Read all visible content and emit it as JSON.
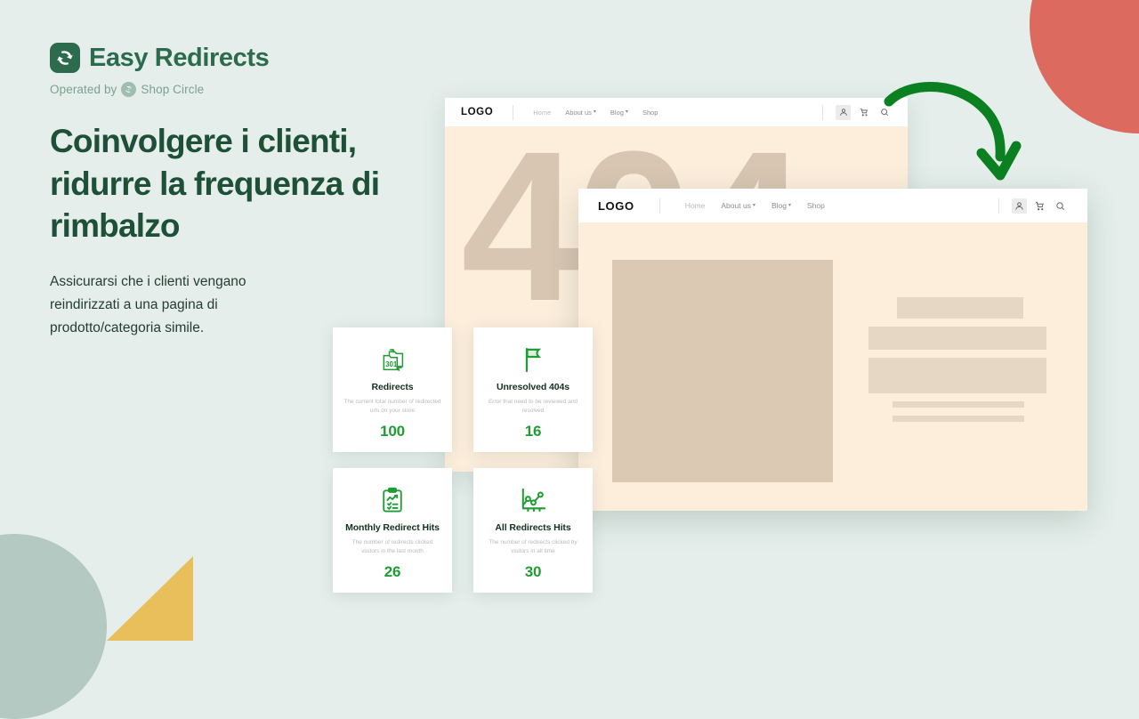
{
  "colors": {
    "background": "#e5eeea",
    "brand_green": "#2d6b4f",
    "headline_green": "#1d5037",
    "accent_green": "#1f9c34",
    "arrow_green": "#0b8020",
    "coral": "#dd6a5e",
    "sage": "#b3c9c2",
    "yellow": "#e9bf5b",
    "cream": "#fdeedc",
    "tan": "#d8c6b2"
  },
  "brand": {
    "name": "Easy Redirects",
    "logo_icon": "redirect-arrows-icon",
    "operated_by_prefix": "Operated by",
    "operated_by_company": "Shop Circle",
    "operated_by_icon": "shop-circle-icon"
  },
  "hero": {
    "headline": "Coinvolgere i clienti, ridurre la frequenza di rimbalzo",
    "subcopy": "Assicurarsi che i clienti vengano reindirizzati a una pagina di prodotto/categoria simile."
  },
  "arrow": {
    "icon": "curved-down-arrow-icon"
  },
  "browser_back": {
    "nav": {
      "logo": "LOGO",
      "links": [
        {
          "label": "Home",
          "has_caret": false,
          "active": true
        },
        {
          "label": "About us",
          "has_caret": true,
          "active": false
        },
        {
          "label": "Blog",
          "has_caret": true,
          "active": false
        },
        {
          "label": "Shop",
          "has_caret": false,
          "active": false
        }
      ],
      "icons": [
        "user-icon",
        "cart-icon",
        "search-icon"
      ]
    },
    "error_code": "404"
  },
  "browser_front": {
    "nav": {
      "logo": "LOGO",
      "links": [
        {
          "label": "Home",
          "has_caret": false,
          "active": true
        },
        {
          "label": "About us",
          "has_caret": true,
          "active": false
        },
        {
          "label": "Blog",
          "has_caret": true,
          "active": false
        },
        {
          "label": "Shop",
          "has_caret": false,
          "active": false
        }
      ],
      "icons": [
        "user-icon",
        "cart-icon",
        "search-icon"
      ]
    }
  },
  "stat_cards": [
    {
      "icon": "redirect-folders-301-icon",
      "title": "Redirects",
      "description": "The current total number of redirected urls on your store",
      "value": "100"
    },
    {
      "icon": "flag-icon",
      "title": "Unresolved 404s",
      "description": "Error that need to be reviewed and resolved",
      "value": "16"
    },
    {
      "icon": "clipboard-chart-icon",
      "title": "Monthly Redirect Hits",
      "description": "The number of redirects clicked visitors in the last month",
      "value": "26"
    },
    {
      "icon": "line-chart-icon",
      "title": "All Redirects Hits",
      "description": "The number of redirects clicked by visitors in all time",
      "value": "30"
    }
  ]
}
